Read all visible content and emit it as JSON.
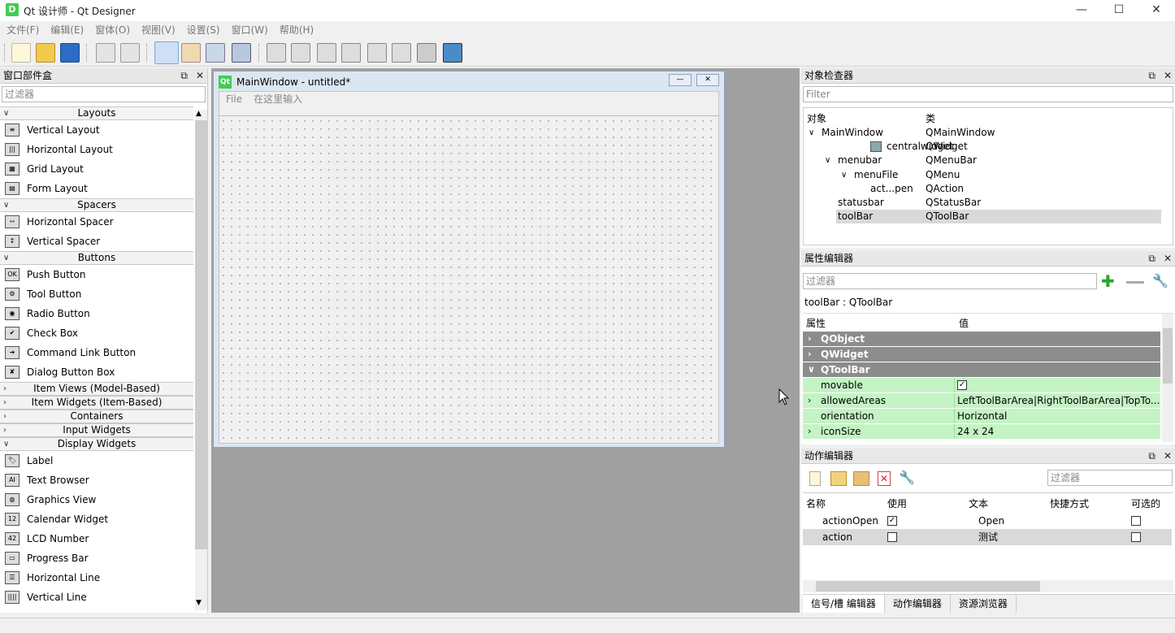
{
  "window": {
    "title": "Qt 设计师 - Qt Designer",
    "app_icon": "D",
    "minimize": "—",
    "maximize": "☐",
    "close": "✕"
  },
  "menu": [
    "文件(F)",
    "编辑(E)",
    "窗体(O)",
    "视图(V)",
    "设置(S)",
    "窗口(W)",
    "帮助(H)"
  ],
  "toolbar_icons": [
    "new-file-icon",
    "open-folder-icon",
    "save-icon",
    "send-to-back-icon",
    "bring-to-front-icon",
    "edit-widgets-icon",
    "edit-tab-order-icon",
    "edit-buddies-icon",
    "edit-signals-icon",
    "layout-horizontal-icon",
    "layout-vertical-icon",
    "layout-hsplitter-icon",
    "layout-vsplitter-icon",
    "layout-grid-icon",
    "layout-form-icon",
    "break-layout-icon",
    "adjust-size-icon"
  ],
  "widget_box": {
    "title": "窗口部件盒",
    "filter_placeholder": "过滤器",
    "sections": [
      {
        "label": "Layouts",
        "expanded": true,
        "items": [
          {
            "label": "Vertical Layout",
            "icon": "vertical-layout-icon",
            "glyph": "≡"
          },
          {
            "label": "Horizontal Layout",
            "icon": "horizontal-layout-icon",
            "glyph": "|||"
          },
          {
            "label": "Grid Layout",
            "icon": "grid-layout-icon",
            "glyph": "▦"
          },
          {
            "label": "Form Layout",
            "icon": "form-layout-icon",
            "glyph": "▤"
          }
        ]
      },
      {
        "label": "Spacers",
        "expanded": true,
        "items": [
          {
            "label": "Horizontal Spacer",
            "icon": "horizontal-spacer-icon",
            "glyph": "⇿"
          },
          {
            "label": "Vertical Spacer",
            "icon": "vertical-spacer-icon",
            "glyph": "↕"
          }
        ]
      },
      {
        "label": "Buttons",
        "expanded": true,
        "items": [
          {
            "label": "Push Button",
            "icon": "push-button-icon",
            "glyph": "OK"
          },
          {
            "label": "Tool Button",
            "icon": "tool-button-icon",
            "glyph": "⚙"
          },
          {
            "label": "Radio Button",
            "icon": "radio-button-icon",
            "glyph": "◉"
          },
          {
            "label": "Check Box",
            "icon": "check-box-icon",
            "glyph": "✔"
          },
          {
            "label": "Command Link Button",
            "icon": "command-link-icon",
            "glyph": "➔"
          },
          {
            "label": "Dialog Button Box",
            "icon": "dialog-button-box-icon",
            "glyph": "✘"
          }
        ]
      },
      {
        "label": "Item Views (Model-Based)",
        "expanded": false,
        "items": []
      },
      {
        "label": "Item Widgets (Item-Based)",
        "expanded": false,
        "items": []
      },
      {
        "label": "Containers",
        "expanded": false,
        "items": []
      },
      {
        "label": "Input Widgets",
        "expanded": false,
        "items": []
      },
      {
        "label": "Display Widgets",
        "expanded": true,
        "items": [
          {
            "label": "Label",
            "icon": "label-icon",
            "glyph": "🏷"
          },
          {
            "label": "Text Browser",
            "icon": "text-browser-icon",
            "glyph": "AI"
          },
          {
            "label": "Graphics View",
            "icon": "graphics-view-icon",
            "glyph": "◍"
          },
          {
            "label": "Calendar Widget",
            "icon": "calendar-icon",
            "glyph": "12"
          },
          {
            "label": "LCD Number",
            "icon": "lcd-number-icon",
            "glyph": "42"
          },
          {
            "label": "Progress Bar",
            "icon": "progress-bar-icon",
            "glyph": "▭"
          },
          {
            "label": "Horizontal Line",
            "icon": "horizontal-line-icon",
            "glyph": "☰"
          },
          {
            "label": "Vertical Line",
            "icon": "vertical-line-icon",
            "glyph": "||||"
          }
        ]
      }
    ]
  },
  "form_window": {
    "title": "MainWindow - untitled*",
    "icon": "Qt",
    "menu_items": [
      "File",
      "在这里输入"
    ],
    "minimize": "—",
    "close": "✕"
  },
  "object_inspector": {
    "title": "对象检查器",
    "filter_placeholder": "Filter",
    "col_object": "对象",
    "col_class": "类",
    "rows": [
      {
        "object": "MainWindow",
        "class": "QMainWindow",
        "depth": 0,
        "arrow": "∨",
        "selected": false,
        "icon": ""
      },
      {
        "object": "centralwidget",
        "class": "QWidget",
        "depth": 2,
        "arrow": "",
        "selected": false,
        "icon": "widget-icon"
      },
      {
        "object": "menubar",
        "class": "QMenuBar",
        "depth": 1,
        "arrow": "∨",
        "selected": false,
        "icon": ""
      },
      {
        "object": "menuFile",
        "class": "QMenu",
        "depth": 2,
        "arrow": "∨",
        "selected": false,
        "icon": ""
      },
      {
        "object": "act...pen",
        "class": "QAction",
        "depth": 3,
        "arrow": "",
        "selected": false,
        "icon": ""
      },
      {
        "object": "statusbar",
        "class": "QStatusBar",
        "depth": 1,
        "arrow": "",
        "selected": false,
        "icon": ""
      },
      {
        "object": "toolBar",
        "class": "QToolBar",
        "depth": 1,
        "arrow": "",
        "selected": true,
        "icon": ""
      }
    ]
  },
  "property_editor": {
    "title": "属性编辑器",
    "filter_placeholder": "过滤器",
    "object_label": "toolBar : QToolBar",
    "col_property": "属性",
    "col_value": "值",
    "rows": [
      {
        "name": "QObject",
        "value": "",
        "type": "group",
        "arrow": "›"
      },
      {
        "name": "QWidget",
        "value": "",
        "type": "group",
        "arrow": "›"
      },
      {
        "name": "QToolBar",
        "value": "",
        "type": "group",
        "arrow": "∨"
      },
      {
        "name": "movable",
        "value": "✓",
        "type": "check",
        "arrow": ""
      },
      {
        "name": "allowedAreas",
        "value": "LeftToolBarArea|RightToolBarArea|TopTo...",
        "type": "prop",
        "arrow": "›"
      },
      {
        "name": "orientation",
        "value": "Horizontal",
        "type": "prop",
        "arrow": ""
      },
      {
        "name": "iconSize",
        "value": "24 x 24",
        "type": "prop",
        "arrow": "›"
      }
    ]
  },
  "action_editor": {
    "title": "动作编辑器",
    "filter_placeholder": "过滤器",
    "cols": [
      "名称",
      "使用",
      "文本",
      "快捷方式",
      "可选的"
    ],
    "rows": [
      {
        "name": "actionOpen",
        "used": true,
        "text": "Open",
        "shortcut": "",
        "checkable": false
      },
      {
        "name": "action",
        "used": false,
        "text": "测试",
        "shortcut": "",
        "checkable": false
      }
    ]
  },
  "bottom_tabs": [
    "信号/槽 编辑器",
    "动作编辑器",
    "资源浏览器"
  ],
  "dock_float": "⧉",
  "dock_close": "✕"
}
